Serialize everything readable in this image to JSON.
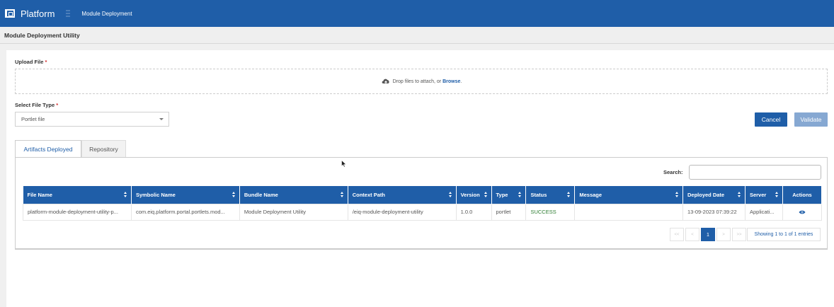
{
  "header": {
    "app_name": "Platform",
    "breadcrumb": "Module Deployment",
    "logo_icon": "platform-logo-icon",
    "menu_icon": "hamburger-icon"
  },
  "page": {
    "title": "Module Deployment Utility"
  },
  "upload": {
    "label": "Upload File",
    "required_mark": "*",
    "drop_text": "Drop files to attach, or",
    "browse_text": "Browse",
    "browse_suffix": ".",
    "icon": "cloud-upload-icon"
  },
  "file_type": {
    "label": "Select File Type",
    "required_mark": "*",
    "selected": "Portlet file"
  },
  "actions": {
    "cancel": "Cancel",
    "validate": "Validate"
  },
  "tabs": [
    {
      "label": "Artifacts Deployed",
      "active": true
    },
    {
      "label": "Repository",
      "active": false
    }
  ],
  "search": {
    "label": "Search:",
    "value": ""
  },
  "table": {
    "columns": [
      "File Name",
      "Symbolic Name",
      "Bundle Name",
      "Context Path",
      "Version",
      "Type",
      "Status",
      "Message",
      "Deployed Date",
      "Server",
      "Actions"
    ],
    "rows": [
      {
        "file_name": "platform-module-deployment-utility-p...",
        "symbolic_name": "com.eiq.platform.portal.portlets.mod...",
        "bundle_name": "Module Deployment Utility",
        "context_path": "/eiq-module-deployment-utility",
        "version": "1.0.0",
        "type": "portlet",
        "status": "SUCCESS",
        "message": "",
        "deployed_date": "13-09-2023 07:39:22",
        "server": "Applicati...",
        "action_icon": "eye-icon"
      }
    ]
  },
  "pagination": {
    "first": "<<",
    "prev": "<",
    "current": "1",
    "next": ">",
    "last": ">>",
    "summary": "Showing 1 to 1 of 1 entries"
  },
  "colors": {
    "primary": "#1f5ea8",
    "validate_disabled": "#86a8d2",
    "success": "#2e7d32",
    "required": "#d32f2f"
  }
}
